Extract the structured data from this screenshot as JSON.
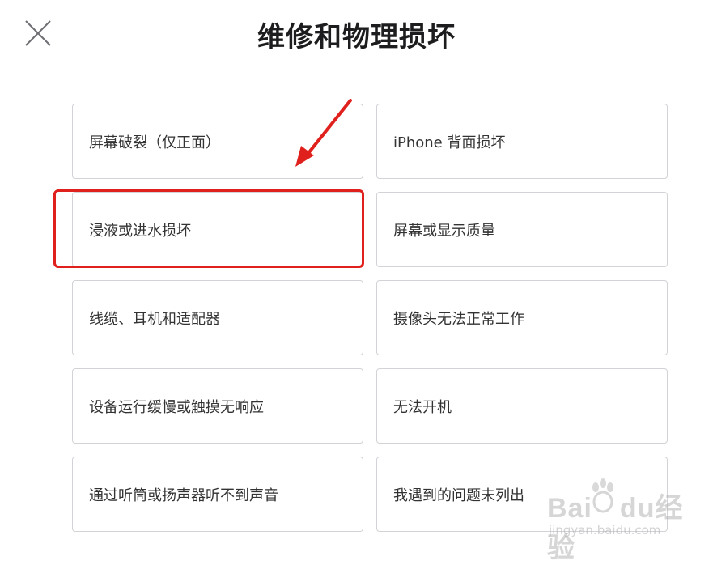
{
  "header": {
    "title": "维修和物理损坏",
    "close_icon": "close-icon"
  },
  "options": [
    {
      "label": "屏幕破裂（仅正面）"
    },
    {
      "label": "iPhone 背面损坏"
    },
    {
      "label": "浸液或进水损坏"
    },
    {
      "label": "屏幕或显示质量"
    },
    {
      "label": "线缆、耳机和适配器"
    },
    {
      "label": "摄像头无法正常工作"
    },
    {
      "label": "设备运行缓慢或触摸无响应"
    },
    {
      "label": "无法开机"
    },
    {
      "label": "通过听筒或扬声器听不到声音"
    },
    {
      "label": "我遇到的问题未列出"
    }
  ],
  "annotation": {
    "highlight_color": "#e0201c",
    "highlighted_option": "浸液或进水损坏"
  },
  "watermark": {
    "logo_text_left": "Bai",
    "logo_text_mid": "du",
    "logo_text_right": "经验",
    "url": "jingyan.baidu.com"
  }
}
